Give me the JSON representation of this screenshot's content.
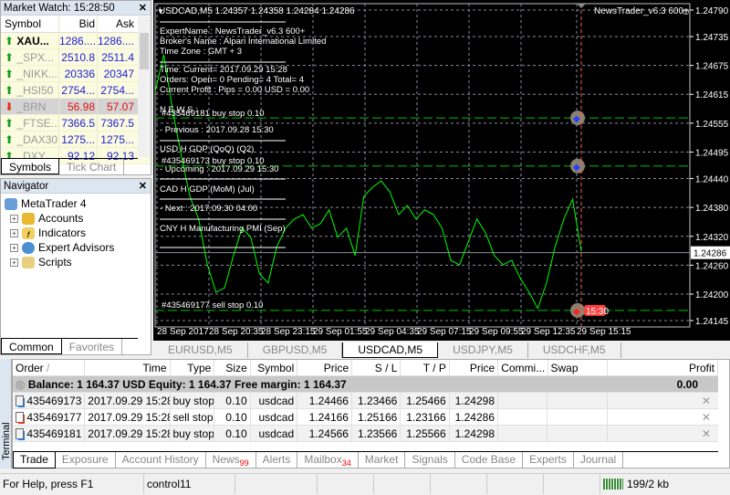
{
  "market_watch": {
    "title": "Market Watch: 15:28:50",
    "columns": [
      "Symbol",
      "Bid",
      "Ask"
    ],
    "rows": [
      {
        "symbol": "XAU...",
        "bid": "1286....",
        "ask": "1286....",
        "dir": "up",
        "bold": true
      },
      {
        "symbol": "_SPX...",
        "bid": "2510.8",
        "ask": "2511.4",
        "dir": "up"
      },
      {
        "symbol": "_NIKK...",
        "bid": "20336",
        "ask": "20347",
        "dir": "up"
      },
      {
        "symbol": "_HSI50",
        "bid": "2754...",
        "ask": "2754...",
        "dir": "up"
      },
      {
        "symbol": "_BRN",
        "bid": "56.98",
        "ask": "57.07",
        "dir": "down"
      },
      {
        "symbol": "_FTSE...",
        "bid": "7366.5",
        "ask": "7367.5",
        "dir": "up"
      },
      {
        "symbol": "_DAX30",
        "bid": "1275...",
        "ask": "1275...",
        "dir": "up"
      },
      {
        "symbol": "_DXY",
        "bid": "92.12",
        "ask": "92.13",
        "dir": "up"
      }
    ],
    "tabs": [
      "Symbols",
      "Tick Chart"
    ]
  },
  "navigator": {
    "title": "Navigator",
    "root": "MetaTrader 4",
    "items": [
      "Accounts",
      "Indicators",
      "Expert Advisors",
      "Scripts"
    ],
    "tabs": [
      "Common",
      "Favorites"
    ]
  },
  "chart": {
    "header": "USDCAD,M5  1.24357 1.24358 1.24284 1.24286",
    "ea_label": "NewsTrader_v6.3 600+",
    "overlay": [
      "ExpertName : NewsTrader_v6.3 600+",
      "Broker's Name :  Alpari International Limited",
      "Time Zone : GMT + 3",
      "Time: Current= 2017.09.29 15:28",
      "Orders: Open= 0 Pending= 4 Total= 4",
      "Current Profit :  Pips = 0.00 USD = 0.00",
      "N E W S :",
      "- Previous  :  2017.09.28 15:30",
      "USD  H  GDP (QoQ) (Q2)",
      "- Upcoming :  2017.09.29 15:30",
      "CAD  H  GDP (MoM) (Jul)",
      "- Next       :  2017.09.30 04:00",
      "CNY  H  Manufacturing PMI (Sep)"
    ],
    "orders": [
      {
        "label": "#435469181 buy stop 0.10",
        "price": 1.24566,
        "type": "buy"
      },
      {
        "label": "#435469173 buy stop 0.10",
        "price": 1.24466,
        "type": "buy"
      },
      {
        "label": "#435469177 sell stop 0.10",
        "price": 1.24166,
        "type": "sell"
      }
    ],
    "event_label": "15:30",
    "price_ticks": [
      "1.24790",
      "1.24735",
      "1.24675",
      "1.24615",
      "1.24555",
      "1.24495",
      "1.24440",
      "1.24380",
      "1.24320",
      "1.24260",
      "1.24200",
      "1.24145"
    ],
    "current_price": "1.24286",
    "time_ticks": [
      "28 Sep 2017",
      "28 Sep 20:35",
      "28 Sep 23:15",
      "29 Sep 01:55",
      "29 Sep 04:35",
      "29 Sep 07:15",
      "29 Sep 09:55",
      "29 Sep 12:35",
      "29 Sep 15:15"
    ],
    "ylim": [
      1.24145,
      1.2479
    ],
    "line_color": "#00ff00",
    "prices": [
      1.24621,
      1.24697,
      1.24583,
      1.24488,
      1.24403,
      1.24356,
      1.24261,
      1.24204,
      1.24213,
      1.2428,
      1.24337,
      1.24318,
      1.24242,
      1.24223,
      1.24299,
      1.24337,
      1.24356,
      1.24365,
      1.24337,
      1.24346,
      1.24375,
      1.24318,
      1.24337,
      1.2428,
      1.24403,
      1.24422,
      1.24435,
      1.24412,
      1.24365,
      1.24384,
      1.24356,
      1.24375,
      1.24365,
      1.24337,
      1.2427,
      1.24261,
      1.24308,
      1.24356,
      1.24327,
      1.2428,
      1.24261,
      1.2427,
      1.24232,
      1.24204,
      1.2417,
      1.24223,
      1.24299,
      1.24356,
      1.24397,
      1.24289
    ]
  },
  "chart_tabs": [
    "EURUSD,M5",
    "GBPUSD,M5",
    "USDCAD,M5",
    "USDJPY,M5",
    "USDCHF,M5"
  ],
  "terminal": {
    "label": "Terminal",
    "columns": [
      "Order",
      "/",
      "Time",
      "Type",
      "Size",
      "Symbol",
      "Price",
      "S / L",
      "T / P",
      "Price",
      "Commi...",
      "Swap",
      "Profit"
    ],
    "balance": "Balance: 1 164.37 USD  Equity: 1 164.37  Free margin: 1 164.37",
    "balance_profit": "0.00",
    "rows": [
      {
        "order": "435469173",
        "time": "2017.09.29 15:28:00",
        "type": "buy stop",
        "size": "0.10",
        "symbol": "usdcad",
        "price": "1.24466",
        "sl": "1.23466",
        "tp": "1.25466",
        "cur": "1.24298"
      },
      {
        "order": "435469177",
        "time": "2017.09.29 15:28:00",
        "type": "sell stop",
        "size": "0.10",
        "symbol": "usdcad",
        "price": "1.24166",
        "sl": "1.25166",
        "tp": "1.23166",
        "cur": "1.24286"
      },
      {
        "order": "435469181",
        "time": "2017.09.29 15:28:01",
        "type": "buy stop",
        "size": "0.10",
        "symbol": "usdcad",
        "price": "1.24566",
        "sl": "1.23566",
        "tp": "1.25566",
        "cur": "1.24298"
      }
    ],
    "tabs": [
      "Trade",
      "Exposure",
      "Account History",
      "News",
      "Alerts",
      "Mailbox",
      "Market",
      "Signals",
      "Code Base",
      "Experts",
      "Journal"
    ],
    "news_count": "99",
    "mailbox_count": "34"
  },
  "status": {
    "help": "For Help, press F1",
    "profile": "control11",
    "traffic": "199/2 kb"
  }
}
